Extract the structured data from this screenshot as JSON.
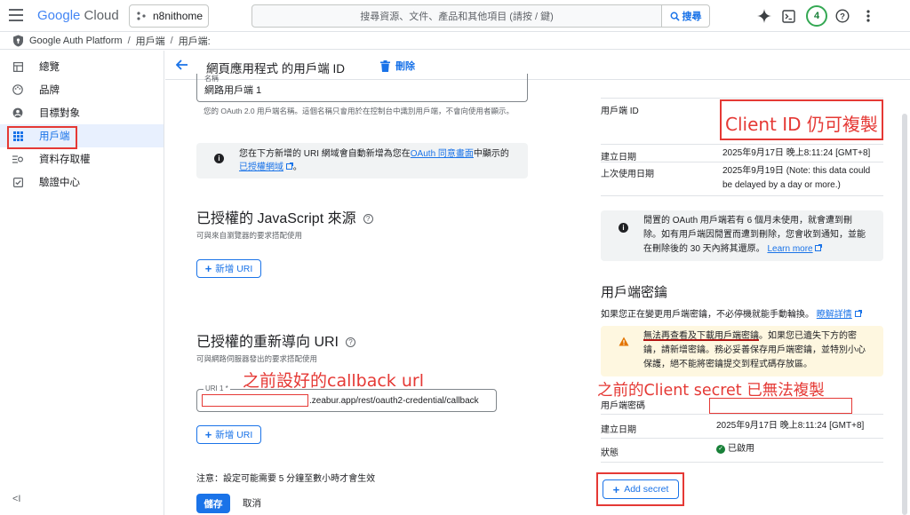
{
  "topbar": {
    "logo_google": "Google",
    "logo_cloud": "Cloud",
    "project": "n8nithome",
    "search_placeholder": "搜尋資源、文件、產品和其他項目 (請按 / 鍵)",
    "search_button": "搜尋",
    "notifications_count": "4"
  },
  "breadcrumb": [
    "Google Auth Platform",
    "用戶端",
    "用戶端:"
  ],
  "sidebar": {
    "items": [
      {
        "label": "總覽",
        "icon": "dashboard-icon"
      },
      {
        "label": "品牌",
        "icon": "palette-icon"
      },
      {
        "label": "目標對象",
        "icon": "person-icon"
      },
      {
        "label": "用戶端",
        "icon": "grid-icon"
      },
      {
        "label": "資料存取權",
        "icon": "data-access-icon"
      },
      {
        "label": "驗證中心",
        "icon": "verification-icon"
      }
    ],
    "active_index": 3
  },
  "page": {
    "title": "網頁應用程式 的用戶端 ID",
    "delete": "刪除"
  },
  "left": {
    "name_label": "名稱",
    "name_value": "網路用戶端 1",
    "name_helper": "您的 OAuth 2.0 用戶端名稱。這個名稱只會用於在控制台中識別用戶端，不會向使用者顯示。",
    "info_text_1": "您在下方新增的 URI 網域會自動新增為您在",
    "info_link_1": "OAuth 同意畫面",
    "info_text_2": "中顯示的",
    "info_link_2": "已授權網域",
    "info_text_3": "。",
    "js_title": "已授權的 JavaScript 來源",
    "js_sub": "可與來自瀏覽器的要求搭配使用",
    "add_uri": "新增 URI",
    "redirect_title": "已授權的重新導向 URI",
    "redirect_sub": "可與網路伺服器發出的要求搭配使用",
    "uri_label": "URI 1 *",
    "uri_value": ".zeabur.app/rest/oauth2-credential/callback",
    "note": "注意：設定可能需要 5 分鐘至數小時才會生效",
    "save": "儲存",
    "cancel": "取消"
  },
  "right": {
    "client_id_label": "用戶端 ID",
    "created_label": "建立日期",
    "created_value": "2025年9月17日 晚上8:11:24 [GMT+8]",
    "last_used_label": "上次使用日期",
    "last_used_value_1": "2025年9月19日 (Note: this data could",
    "last_used_value_2": "be delayed by a day or more.)",
    "idle_info_1": "閒置的 OAuth 用戶端若有 6 個月未使用，就會遭到刪",
    "idle_info_2": "除。如有用戶端因閒置而遭到刪除，您會收到通知，並能",
    "idle_info_3": "在刪除後的 30 天內將其還原。",
    "learn_more": "Learn more",
    "secret_title": "用戶端密鑰",
    "secret_sub": "如果您正在變更用戶端密鑰，不必停機就能手動輪換。",
    "learn_details": "瞭解詳情",
    "warn_1a": "無法再查看及下載用戶端密鑰",
    "warn_1b": "。如果您已遺失下方的密",
    "warn_2": "鑰，請新增密鑰。務必妥善保存用戶端密鑰，並特別小心",
    "warn_3": "保護，絕不能將密鑰提交到程式碼存放區。",
    "secret_label": "用戶端密碼",
    "secret_created_label": "建立日期",
    "secret_created_value": "2025年9月17日 晚上8:11:24 [GMT+8]",
    "status_label": "狀態",
    "status_value": "已啟用",
    "add_secret": "Add secret"
  },
  "annotations": {
    "client_id_note": "Client ID 仍可複製",
    "callback_note": "之前設好的callback url",
    "secret_note": "之前的Client secret 已無法複製"
  }
}
